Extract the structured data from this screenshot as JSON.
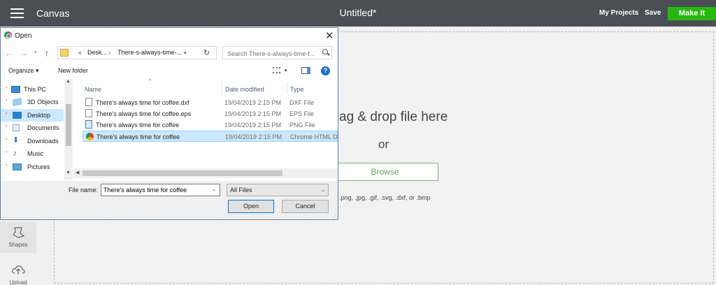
{
  "appbar": {
    "app_name": "Canvas",
    "doc_title": "Untitled*",
    "my_projects": "My Projects",
    "save": "Save",
    "make_it": "Make It",
    "accent": "#26b80e"
  },
  "left_toolbar": {
    "shapes": "Shapes",
    "upload": "Upload"
  },
  "dropzone": {
    "drop_text": "ag & drop file here",
    "or": "or",
    "browse": "Browse",
    "formats": ".png, .jpg, .gif, .svg, .dxf, or .bmp"
  },
  "dialog": {
    "title": "Open",
    "close": "✕",
    "address": {
      "chevrons": "«",
      "desktop": "Desk...",
      "separator": "›",
      "folder": "There-s-always-time-...",
      "refresh": "↻"
    },
    "search_placeholder": "Search There-s-always-time-f...",
    "organize": "Organize ▾",
    "new_folder": "New folder",
    "help": "?",
    "nav": {
      "items": [
        {
          "label": "This PC",
          "icon": "computer-icon"
        },
        {
          "label": "3D Objects",
          "icon": "cube-icon"
        },
        {
          "label": "Desktop",
          "icon": "desktop-icon",
          "selected": true
        },
        {
          "label": "Documents",
          "icon": "document-icon"
        },
        {
          "label": "Downloads",
          "icon": "download-icon"
        },
        {
          "label": "Music",
          "icon": "music-icon"
        },
        {
          "label": "Pictures",
          "icon": "pictures-icon"
        }
      ]
    },
    "columns": {
      "name": "Name",
      "date": "Date modified",
      "type": "Type"
    },
    "files": [
      {
        "name": "There's always time for coffee.dxf",
        "date": "19/04/2019 2:15 PM",
        "type": "DXF File",
        "icon": "file-icon"
      },
      {
        "name": "There's always time for coffee.eps",
        "date": "19/04/2019 2:15 PM",
        "type": "EPS File",
        "icon": "file-icon"
      },
      {
        "name": "There's always time for coffee",
        "date": "19/04/2019 2:15 PM",
        "type": "PNG File",
        "icon": "image-file-icon"
      },
      {
        "name": "There's always time for coffee",
        "date": "19/04/2019 2:15 PM",
        "type": "Chrome HTML D",
        "icon": "chrome-file-icon",
        "selected": true
      }
    ],
    "file_name_label": "File name:",
    "file_name_value": "There's always time for coffee",
    "filter": "All Files",
    "open": "Open",
    "cancel": "Cancel"
  }
}
